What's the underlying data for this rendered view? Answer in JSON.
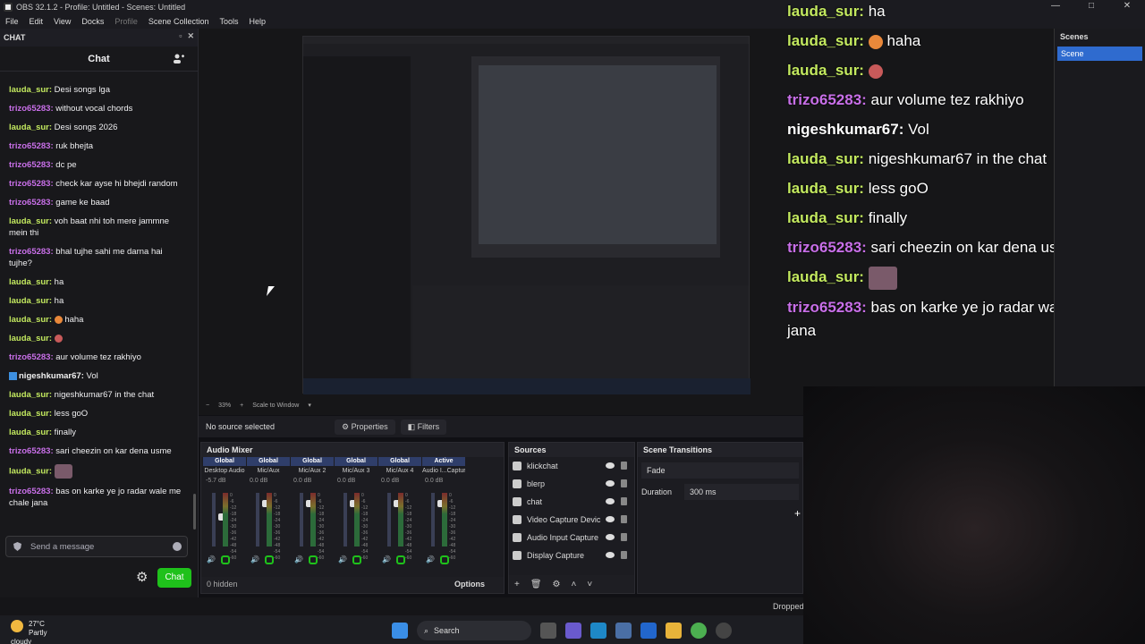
{
  "window": {
    "title": "OBS 32.1.2 - Profile: Untitled - Scenes: Untitled",
    "min": "—",
    "max": "□",
    "close": "✕"
  },
  "menu": [
    "File",
    "Edit",
    "View",
    "Docks",
    "Profile",
    "Scene Collection",
    "Tools",
    "Help"
  ],
  "chat_dock": {
    "header": "CHAT",
    "title": "Chat",
    "messages": [
      {
        "user": "lauda_sur:",
        "text": " Desi songs lga"
      },
      {
        "user": "trizo65283:",
        "text": " without vocal chords"
      },
      {
        "user": "lauda_sur:",
        "text": " Desi songs 2026"
      },
      {
        "user": "trizo65283:",
        "text": " ruk bhejta"
      },
      {
        "user": "trizo65283:",
        "text": " dc pe"
      },
      {
        "user": "trizo65283:",
        "text": " check kar ayse hi bhejdi random"
      },
      {
        "user": "trizo65283:",
        "text": " game ke baad"
      },
      {
        "user": "lauda_sur:",
        "text": " voh baat nhi toh mere jammne mein thi"
      },
      {
        "user": "trizo65283:",
        "text": " bhal tujhe sahi me darna hai tujhe?"
      },
      {
        "user": "lauda_sur:",
        "text": " ha"
      },
      {
        "user": "lauda_sur:",
        "text": " ha"
      },
      {
        "user": "lauda_sur:",
        "text": " haha"
      },
      {
        "user": "lauda_sur:",
        "text": ""
      },
      {
        "user": "trizo65283:",
        "text": " aur volume tez rakhiyo"
      },
      {
        "user": "nigeshkumar67:",
        "text": " Vol"
      },
      {
        "user": "lauda_sur:",
        "text": " nigeshkumar67 in the chat"
      },
      {
        "user": "lauda_sur:",
        "text": " less goO"
      },
      {
        "user": "lauda_sur:",
        "text": " finally"
      },
      {
        "user": "trizo65283:",
        "text": " sari cheezin on kar dena usme"
      },
      {
        "user": "lauda_sur:",
        "text": ""
      },
      {
        "user": "trizo65283:",
        "text": " bas on karke ye jo radar wale me chale jana"
      }
    ],
    "input_placeholder": "Send a message",
    "send_label": "Chat"
  },
  "overlay": {
    "lines": [
      {
        "user": "lauda_sur:",
        "text": " ha"
      },
      {
        "user": "lauda_sur:",
        "text": " haha"
      },
      {
        "user": "lauda_sur:",
        "text": ""
      },
      {
        "user": "trizo65283:",
        "text": " aur volume tez rakhiyo"
      },
      {
        "user": "nigeshkumar67:",
        "text": " Vol"
      },
      {
        "user": "lauda_sur:",
        "text": " nigeshkumar67 in the chat"
      },
      {
        "user": "lauda_sur:",
        "text": " less goO"
      },
      {
        "user": "lauda_sur:",
        "text": " finally"
      },
      {
        "user": "trizo65283:",
        "text": " sari cheezin on kar dena usme"
      },
      {
        "user": "lauda_sur:",
        "text": ""
      },
      {
        "user": "trizo65283:",
        "text": " bas on karke ye jo radar wale me chale jana"
      }
    ]
  },
  "scenes": {
    "header": "Scenes",
    "items": [
      "Scene"
    ]
  },
  "zoom": {
    "minus": "−",
    "value": "33%",
    "plus": "+",
    "mode": "Scale to Window"
  },
  "context": {
    "no_source": "No source selected",
    "properties": "Properties",
    "filters": "Filters"
  },
  "mixer": {
    "header": "Audio Mixer",
    "channels": [
      {
        "badge": "Global",
        "name": "Desktop Audio",
        "db": "-5.7 dB",
        "level": 0.55
      },
      {
        "badge": "Global",
        "name": "Mic/Aux",
        "db": "0.0 dB",
        "level": 0.85
      },
      {
        "badge": "Global",
        "name": "Mic/Aux 2",
        "db": "0.0 dB",
        "level": 0.85
      },
      {
        "badge": "Global",
        "name": "Mic/Aux 3",
        "db": "0.0 dB",
        "level": 0.85
      },
      {
        "badge": "Global",
        "name": "Mic/Aux 4",
        "db": "0.0 dB",
        "level": 0.85
      },
      {
        "badge": "Active",
        "name": "Audio I...Capture",
        "db": "0.0 dB",
        "level": 0.85
      }
    ],
    "scale": [
      "0",
      "-6",
      "-12",
      "-18",
      "-24",
      "-30",
      "-36",
      "-42",
      "-48",
      "-54",
      "-60"
    ],
    "hidden": "0 hidden"
  },
  "sources": {
    "header": "Sources",
    "items": [
      "klickchat",
      "blerp",
      "chat",
      "Video Capture Devic",
      "Audio Input Capture",
      "Display Capture"
    ],
    "options": "Options"
  },
  "transitions": {
    "header": "Scene Transitions",
    "type": "Fade",
    "duration_label": "Duration",
    "duration": "300 ms",
    "add": "+"
  },
  "status": {
    "dropped": "Dropped"
  },
  "taskbar": {
    "temp": "27°C",
    "weather": "Partly cloudy",
    "search": "Search"
  },
  "colors": {
    "lauda": "#c3e95f",
    "trizo": "#c86fe8",
    "accent": "#2f6bcf",
    "chat_button": "#1fc11b"
  }
}
